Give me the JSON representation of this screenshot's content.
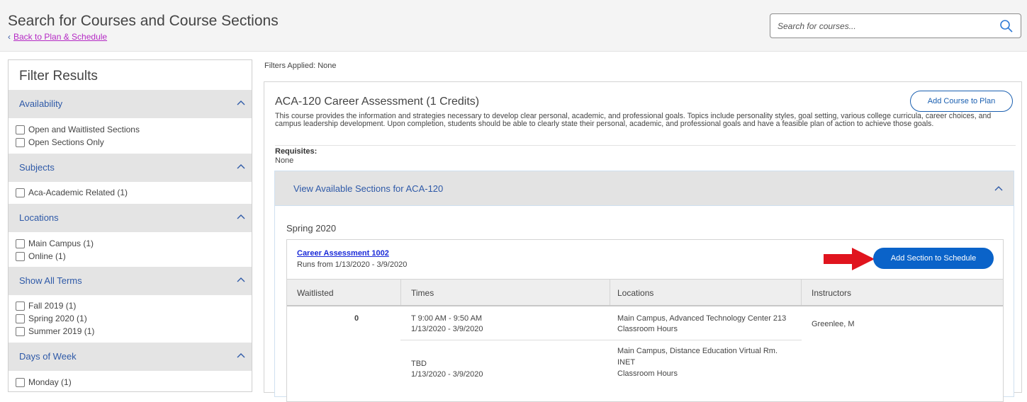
{
  "header": {
    "title": "Search for Courses and Course Sections",
    "back_link": "Back to Plan & Schedule",
    "search_placeholder": "Search for courses..."
  },
  "sidebar": {
    "title": "Filter Results",
    "facets": [
      {
        "label": "Availability",
        "options": [
          "Open and Waitlisted Sections",
          "Open Sections Only"
        ]
      },
      {
        "label": "Subjects",
        "options": [
          "Aca-Academic Related (1)"
        ]
      },
      {
        "label": "Locations",
        "options": [
          "Main Campus (1)",
          "Online (1)"
        ]
      },
      {
        "label": "Show All Terms",
        "options": [
          "Fall 2019 (1)",
          "Spring 2020 (1)",
          "Summer 2019 (1)"
        ]
      },
      {
        "label": "Days of Week",
        "options": [
          "Monday (1)"
        ]
      }
    ]
  },
  "main": {
    "filters_applied": "Filters Applied: None",
    "course": {
      "title": "ACA-120 Career Assessment (1 Credits)",
      "add_button": "Add Course to Plan",
      "description": "This course provides the information and strategies necessary to develop clear personal, academic, and professional goals. Topics include personality styles, goal setting, various college curricula, career choices, and campus leadership development. Upon completion, students should be able to clearly state their personal, academic, and professional goals and have a feasible plan of action to achieve those goals.",
      "requisites_label": "Requisites:",
      "requisites_value": "None",
      "sections_toggle": "View Available Sections for ACA-120",
      "term": "Spring 2020",
      "section": {
        "name": "Career Assessment 1002",
        "runs": "Runs from 1/13/2020 - 3/9/2020",
        "add_button": "Add Section to Schedule",
        "columns": [
          "Waitlisted",
          "Times",
          "Locations",
          "Instructors"
        ],
        "rows": [
          {
            "waitlisted": "0",
            "time": "T 9:00 AM - 9:50 AM",
            "dates": "1/13/2020 - 3/9/2020",
            "location": "Main Campus, Advanced Technology Center 213",
            "location_type": "Classroom Hours",
            "instructor": "Greenlee, M"
          },
          {
            "time": "TBD",
            "dates": "1/13/2020 - 3/9/2020",
            "location": "Main Campus, Distance Education Virtual Rm.",
            "location_2": "INET",
            "location_type": "Classroom Hours"
          }
        ]
      }
    }
  },
  "colors": {
    "accent": "#0a63c9",
    "link": "#2f5aa8",
    "arrow": "#e0141e",
    "back_link": "#b429c4"
  }
}
